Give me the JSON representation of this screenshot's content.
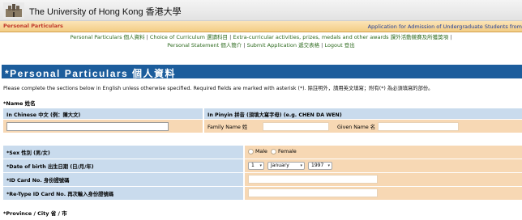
{
  "header": {
    "university_name": "The University of Hong Kong 香港大學",
    "active_tab": "Personal Particulars",
    "app_title": "Application for Admission of Undergraduate Students from"
  },
  "nav": {
    "line1": [
      {
        "label": "Personal Particulars   個人資料"
      },
      {
        "label": "Choice of Curriculum   選讀科目"
      },
      {
        "label": "Extra-curricular activities, prizes, medals and other awards   課外活動競賽及所獲獎項"
      }
    ],
    "line2": [
      {
        "label": "Personal Statement   個人簡介"
      },
      {
        "label": "Submit Application   遞交表格"
      },
      {
        "label": "Logout   登出"
      }
    ],
    "separator": "|"
  },
  "section": {
    "title": "*Personal Particulars   個人資料"
  },
  "instructions": "Please complete the sections below in English unless otherwise specified. Required fields are marked with asterisk (*).  除註明外，請用英文填寫；附有(*) 為必須填寫的部份。",
  "name_section": {
    "label": "*Name  姓名",
    "chinese_header": "In Chinese   中文  (例：陳大文)",
    "pinyin_header": "In Pinyin   拼音   (須填大寫字母)   (e.g. CHEN DA WEN)",
    "family_name_label": "Family Name 姓",
    "given_name_label": "Given Name 名"
  },
  "fields": {
    "sex_label": "*Sex  性別 (男/女)",
    "sex_options": [
      "Male",
      "Female"
    ],
    "dob_label": "*Date of birth   出生日期 (日/月/年)",
    "dob_day": "1",
    "dob_month": "January",
    "dob_year": "1997",
    "id_label": "*ID Card No.   身份證號碼",
    "retype_id_label": "*Re-Type ID Card No.   再次輸入身份證號碼",
    "province_label": "*Province / City   省 / 市"
  },
  "colors": {
    "section_bar": "#1c5d9c",
    "label_cell": "#c9dbed",
    "value_cell": "#f7d8b4",
    "tab_text": "#c0392b",
    "nav_link": "#2e6b1f"
  }
}
